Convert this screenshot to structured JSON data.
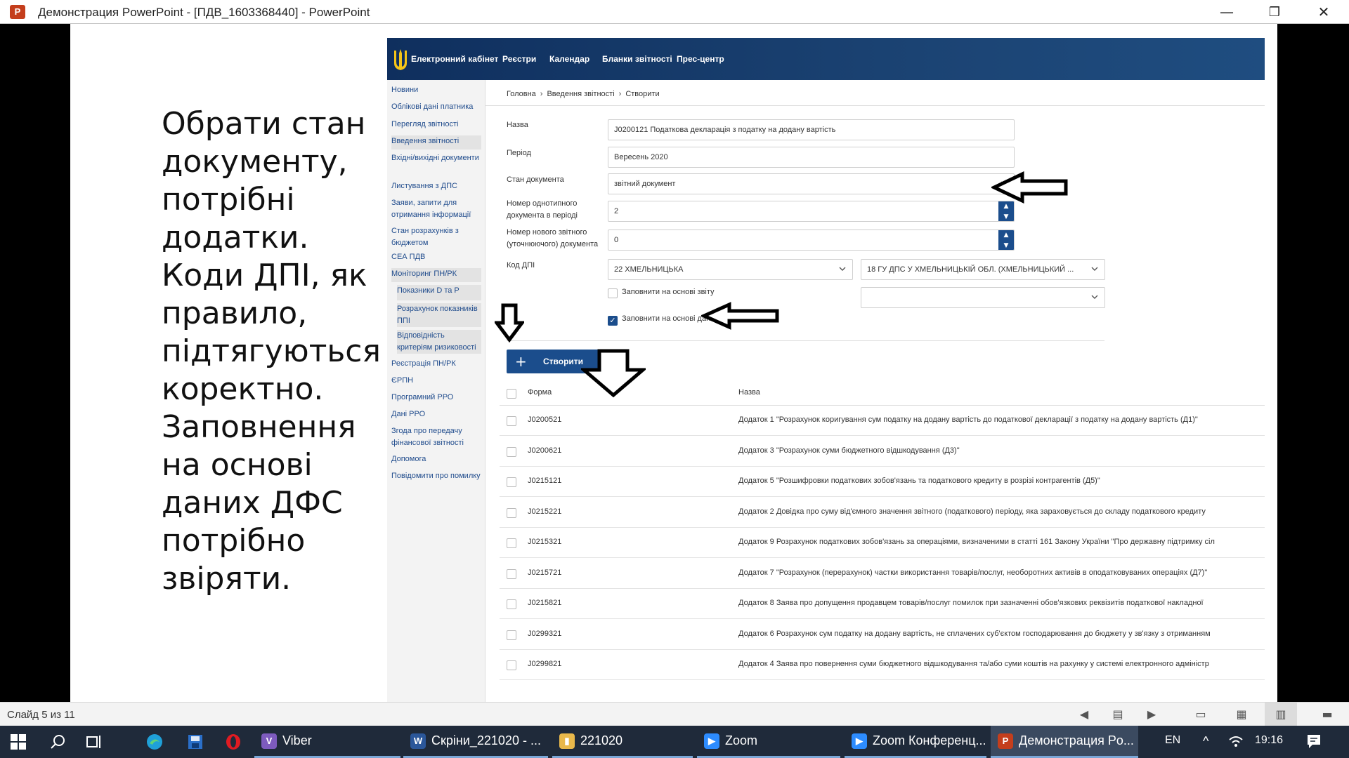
{
  "window": {
    "title": "Демонстрация PowerPoint - [ПДВ_1603368440] - PowerPoint",
    "app_logo": "P",
    "minimize": "—",
    "restore": "❐",
    "close": "✕"
  },
  "slide": {
    "text": "Обрати стан документу, потрібні додатки. Коди ДПІ, як правило, підтягуються коректно. Заповнення на основі даних ДФС потрібно звіряти."
  },
  "site": {
    "nav": [
      "Електронний кабінет",
      "Реєстри",
      "Календар",
      "Бланки звітності",
      "Прес-центр"
    ],
    "sidebar": [
      {
        "label": "Новини",
        "sub": false,
        "hl": false
      },
      {
        "label": "Облікові дані платника",
        "sub": false,
        "hl": false
      },
      {
        "label": "Перегляд звітності",
        "sub": false,
        "hl": false
      },
      {
        "label": "Введення звітності",
        "sub": false,
        "hl": true
      },
      {
        "label": "Вхідні/вихідні документи",
        "sub": false,
        "hl": false
      },
      {
        "label": "Листування з ДПС",
        "sub": false,
        "hl": false
      },
      {
        "label": "Заяви, запити для отримання інформації",
        "sub": false,
        "hl": false
      },
      {
        "label": "Стан розрахунків з бюджетом",
        "sub": false,
        "hl": false
      },
      {
        "label": "СЕА ПДВ",
        "sub": false,
        "hl": false
      },
      {
        "label": "Моніторинг ПН/РК",
        "sub": false,
        "hl": true
      },
      {
        "label": "Показники D та P",
        "sub": true,
        "hl": true
      },
      {
        "label": "Розрахунок показників ППІ",
        "sub": true,
        "hl": true
      },
      {
        "label": "Відповідність критеріям ризиковості",
        "sub": true,
        "hl": true
      },
      {
        "label": "Реєстрація ПН/РК",
        "sub": false,
        "hl": false
      },
      {
        "label": "ЄРПН",
        "sub": false,
        "hl": false
      },
      {
        "label": "Програмний РРО",
        "sub": false,
        "hl": false
      },
      {
        "label": "Дані РРО",
        "sub": false,
        "hl": false
      },
      {
        "label": "Згода про передачу фінансової звітності",
        "sub": false,
        "hl": false
      },
      {
        "label": "Допомога",
        "sub": false,
        "hl": false
      },
      {
        "label": "Повідомити про помилку",
        "sub": false,
        "hl": false
      }
    ],
    "breadcrumb": [
      "Головна",
      "Введення звітності",
      "Створити"
    ],
    "form": {
      "name_label": "Назва",
      "name_value": "J0200121 Податкова декларація з податку на додану вартість",
      "period_label": "Період",
      "period_value": "Вересень 2020",
      "state_label": "Стан документа",
      "state_value": "звітний документ",
      "num_label": "Номер однотипного документа в періоді",
      "num_value": "2",
      "newnum_label": "Номер нового звітного (уточнюючого) документа",
      "newnum_value": "0",
      "dpi_label": "Код ДПІ",
      "dpi_region": "22 ХМЕЛЬНИЦЬКА",
      "dpi_office": "18 ГУ ДПС У ХМЕЛЬНИЦЬКІЙ ОБЛ. (ХМЕЛЬНИЦЬКИЙ ...",
      "fill_report_label": "Заповнити на основі звіту",
      "fill_report_checked": false,
      "fill_dps_label": "Заповнити на основі даних ДПС",
      "fill_dps_checked": true
    },
    "create_button": "Створити",
    "table": {
      "col_form": "Форма",
      "col_name": "Назва",
      "rows": [
        {
          "code": "J0200521",
          "name": "Додаток 1 \"Розрахунок коригування сум податку на додану вартість до податкової декларації з податку на додану вартість (Д1)\""
        },
        {
          "code": "J0200621",
          "name": "Додаток 3 \"Розрахунок суми бюджетного відшкодування (Д3)\""
        },
        {
          "code": "J0215121",
          "name": "Додаток 5 \"Розшифровки податкових зобов'язань та податкового кредиту в розрізі контрагентів (Д5)\""
        },
        {
          "code": "J0215221",
          "name": "Додаток 2 Довідка про суму від'ємного значення звітного (податкового) періоду, яка зараховується до складу податкового кредиту"
        },
        {
          "code": "J0215321",
          "name": "Додаток 9 Розрахунок податкових зобов'язань за операціями, визначеними в статті 161 Закону України \"Про державну підтримку сіл"
        },
        {
          "code": "J0215721",
          "name": "Додаток 7 \"Розрахунок (перерахунок) частки використання товарів/послуг, необоротних активів в оподатковуваних операціях (Д7)\""
        },
        {
          "code": "J0215821",
          "name": "Додаток 8 Заява про допущення продавцем товарів/послуг помилок при зазначенні обов'язкових реквізитів податкової накладної"
        },
        {
          "code": "J0299321",
          "name": "Додаток 6 Розрахунок сум податку на додану вартість, не сплачених суб'єктом господарювання до бюджету у зв'язку з отриманням"
        },
        {
          "code": "J0299821",
          "name": "Додаток 4 Заява про повернення суми бюджетного відшкодування та/або суми коштів на рахунку у системі електронного адміністр"
        }
      ]
    }
  },
  "statusbar": {
    "slide_count": "Слайд 5 из 11"
  },
  "taskbar": {
    "apps": [
      {
        "label": "Viber",
        "icon": "viber-icon",
        "color": "#7d5bbe"
      },
      {
        "label": "Скріни_221020 - ...",
        "icon": "word-icon",
        "color": "#2b579a"
      },
      {
        "label": "221020",
        "icon": "folder-icon",
        "color": "#e8b84b"
      },
      {
        "label": "Zoom",
        "icon": "zoom-icon",
        "color": "#2d8cff"
      },
      {
        "label": "Zoom Конференц...",
        "icon": "zoom-icon",
        "color": "#2d8cff"
      },
      {
        "label": "Демонстрация Po...",
        "icon": "powerpoint-icon",
        "color": "#c43e1c"
      }
    ],
    "lang": "EN",
    "time": "19:16"
  }
}
